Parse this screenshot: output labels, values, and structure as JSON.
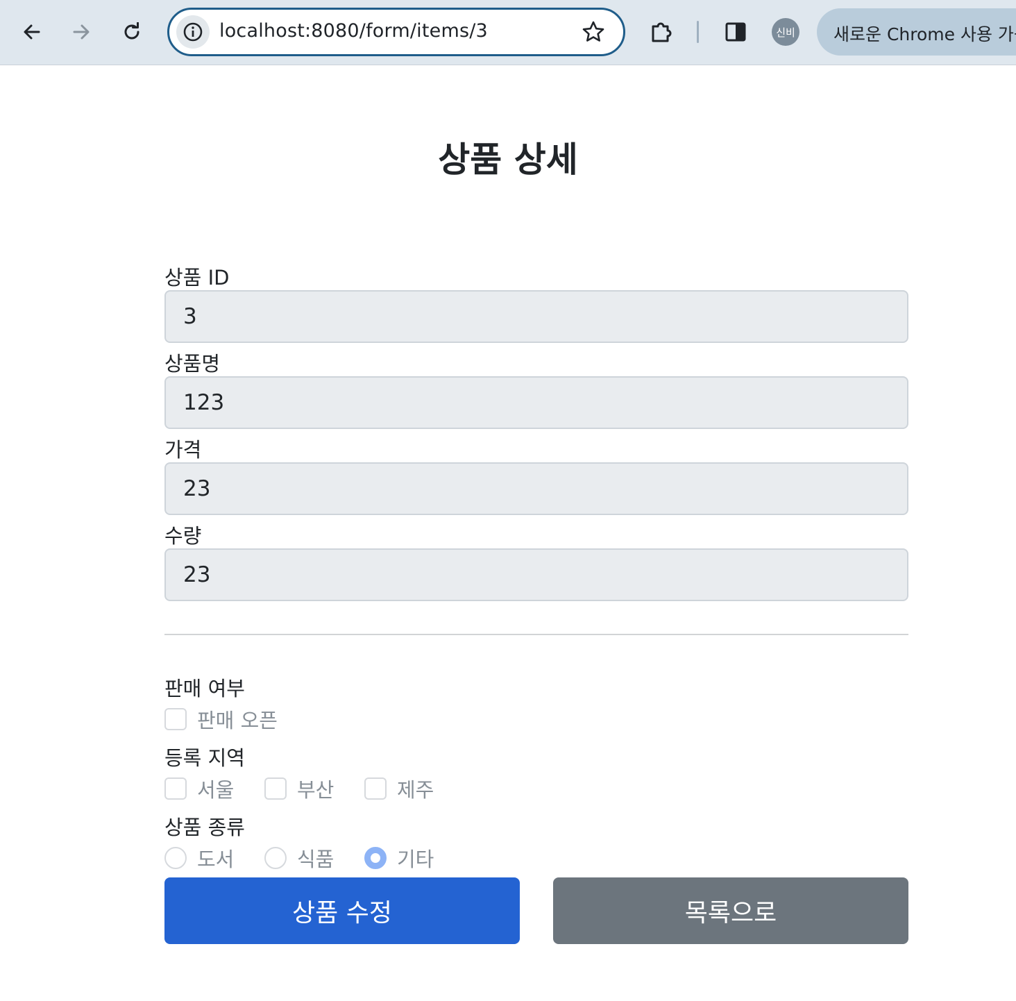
{
  "browser": {
    "url": "localhost:8080/form/items/3",
    "profile_label": "신비",
    "promo_text": "새로운 Chrome 사용 가능"
  },
  "page": {
    "title": "상품 상세",
    "fields": {
      "id": {
        "label": "상품 ID",
        "value": "3"
      },
      "name": {
        "label": "상품명",
        "value": "123"
      },
      "price": {
        "label": "가격",
        "value": "23"
      },
      "quantity": {
        "label": "수량",
        "value": "23"
      }
    },
    "sale": {
      "label": "판매 여부",
      "option": {
        "label": "판매 오픈",
        "checked": false
      }
    },
    "regions": {
      "label": "등록 지역",
      "options": [
        {
          "label": "서울",
          "checked": false
        },
        {
          "label": "부산",
          "checked": false
        },
        {
          "label": "제주",
          "checked": false
        }
      ]
    },
    "item_type": {
      "label": "상품 종류",
      "options": [
        {
          "label": "도서",
          "selected": false
        },
        {
          "label": "식품",
          "selected": false
        },
        {
          "label": "기타",
          "selected": true
        }
      ]
    },
    "buttons": {
      "edit": "상품 수정",
      "list": "목록으로"
    }
  },
  "icons": [
    "back-arrow-icon",
    "forward-arrow-icon",
    "reload-icon",
    "site-info-icon",
    "bookmark-star-icon",
    "extensions-puzzle-icon",
    "side-panel-icon"
  ]
}
